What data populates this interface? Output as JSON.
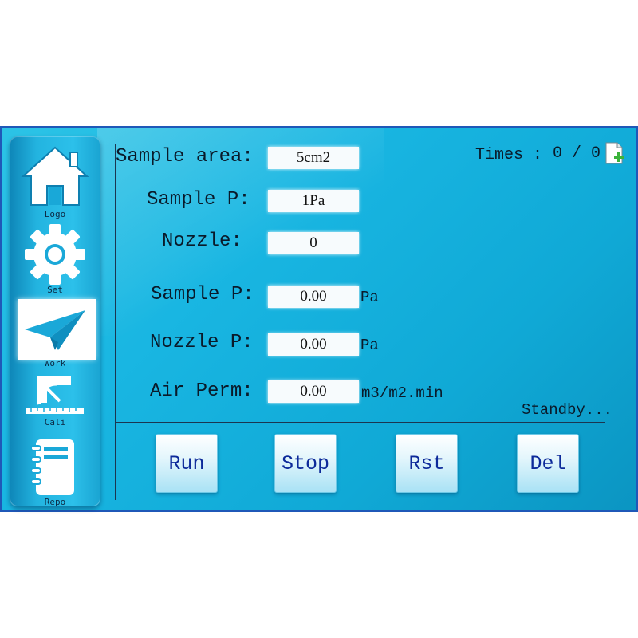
{
  "sidebar": {
    "items": [
      {
        "label": "Logo",
        "icon": "home-icon"
      },
      {
        "label": "Set",
        "icon": "gear-icon"
      },
      {
        "label": "Work",
        "icon": "paper-plane-icon"
      },
      {
        "label": "Cali",
        "icon": "protractor-ruler-icon"
      },
      {
        "label": "Repo",
        "icon": "notebook-icon"
      }
    ],
    "active": "Work"
  },
  "settings": {
    "sample_area_label": "Sample area:",
    "sample_area_value": "5cm2",
    "sample_p_label": "Sample P:",
    "sample_p_value": "1Pa",
    "nozzle_label": "Nozzle:",
    "nozzle_value": "0"
  },
  "times": {
    "label": "Times :",
    "count": "0 / 0",
    "icon": "add-document-icon"
  },
  "readings": {
    "sample_p_label": "Sample P:",
    "sample_p_value": "0.00",
    "sample_p_unit": "Pa",
    "nozzle_p_label": "Nozzle P:",
    "nozzle_p_value": "0.00",
    "nozzle_p_unit": "Pa",
    "air_perm_label": "Air Perm:",
    "air_perm_value": "0.00",
    "air_perm_unit": "m3/m2.min"
  },
  "status": "Standby...",
  "buttons": {
    "run": "Run",
    "stop": "Stop",
    "rst": "Rst",
    "del": "Del"
  },
  "colors": {
    "screen_bg": "#19b6e2",
    "border": "#1f58b8",
    "button_text": "#0d2a9a"
  }
}
